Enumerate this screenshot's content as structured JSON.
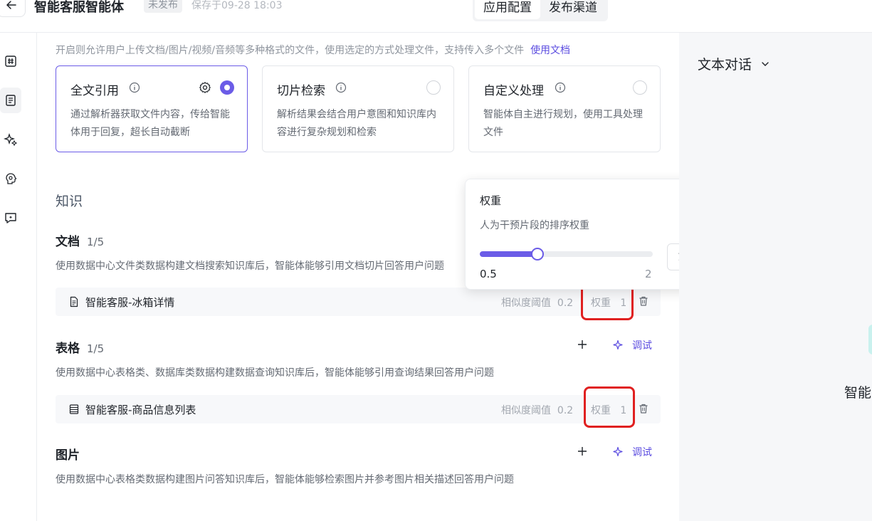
{
  "header": {
    "title": "智能客服智能体",
    "status": "未发布",
    "saved": "保存于09-28 18:03",
    "tabs": [
      "应用配置",
      "发布渠道"
    ]
  },
  "upload": {
    "hint": "开启则允许用户上传文档/图片/视频/音频等多种格式的文件，使用选定的方式处理文件，支持传入多个文件",
    "doc_link": "使用文档",
    "modes": [
      {
        "title": "全文引用",
        "desc": "通过解析器获取文件内容，传给智能体用于回复，超长自动截断",
        "selected": true
      },
      {
        "title": "切片检索",
        "desc": "解析结果会结合用户意图和知识库内容进行复杂规划和检索",
        "selected": false
      },
      {
        "title": "自定义处理",
        "desc": "智能体自主进行规划，使用工具处理文件",
        "selected": false
      }
    ]
  },
  "knowledge": {
    "title": "知识",
    "docs": {
      "title": "文档",
      "count": "1/5",
      "desc": "使用数据中心文件类数据构建文档搜索知识库后，智能体能够引用文档切片回答用户问题",
      "items": [
        {
          "name": "智能客服-冰箱详情",
          "sim_label": "相似度阈值",
          "sim": "0.2",
          "weight_label": "权重",
          "weight": "1"
        }
      ]
    },
    "tables": {
      "title": "表格",
      "count": "1/5",
      "desc": "使用数据中心表格类、数据库类数据构建数据查询知识库后，智能体能够引用查询结果回答用户问题",
      "debug": "调试",
      "items": [
        {
          "name": "智能客服-商品信息列表",
          "sim_label": "相似度阈值",
          "sim": "0.2",
          "weight_label": "权重",
          "weight": "1"
        }
      ]
    },
    "images": {
      "title": "图片",
      "desc": "使用数据中心表格类数据构建图片问答知识库后，智能体能够检索图片并参考图片相关描述回答用户问题",
      "debug": "调试"
    }
  },
  "weight_popover": {
    "title": "权重",
    "desc": "人为干预片段的排序权重",
    "min": "0.5",
    "max": "2",
    "value": "1.0",
    "fraction": 0.333
  },
  "right_panel": {
    "title": "文本对话",
    "agent_name": "智能"
  },
  "colors": {
    "accent": "#6b5ce7",
    "highlight": "#e02020"
  }
}
